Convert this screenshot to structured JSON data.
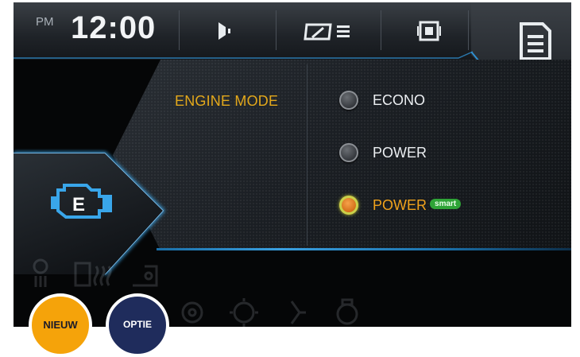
{
  "status_bar": {
    "ampm": "PM",
    "time": "12:00"
  },
  "top_icons": [
    "audio-speaker-icon",
    "gauge-menu-icon",
    "phone-screen-icon",
    "document-menu-icon"
  ],
  "engine_panel": {
    "title": "ENGINE MODE",
    "options": [
      {
        "label": "ECONO",
        "selected": false
      },
      {
        "label": "POWER",
        "selected": false
      },
      {
        "label": "POWER",
        "badge": "smart",
        "selected": true
      }
    ]
  },
  "side_tab": {
    "icon": "engine-check-icon",
    "icon_letter": "E"
  },
  "faint_icons": [
    "glow-plug-icon",
    "fuel-heater-icon",
    "oil-icon",
    "gear-settings-icon",
    "brake-icon",
    "seat-icon",
    "engine-oil-icon"
  ],
  "badges": {
    "new_label": "NIEUW",
    "option_label": "OPTIE"
  },
  "colors": {
    "accent_orange": "#e3a81b",
    "glow_blue": "#3aa0e0",
    "smart_green": "#2fa437",
    "badge_new": "#f5a30a",
    "badge_option": "#1f2c5c"
  }
}
